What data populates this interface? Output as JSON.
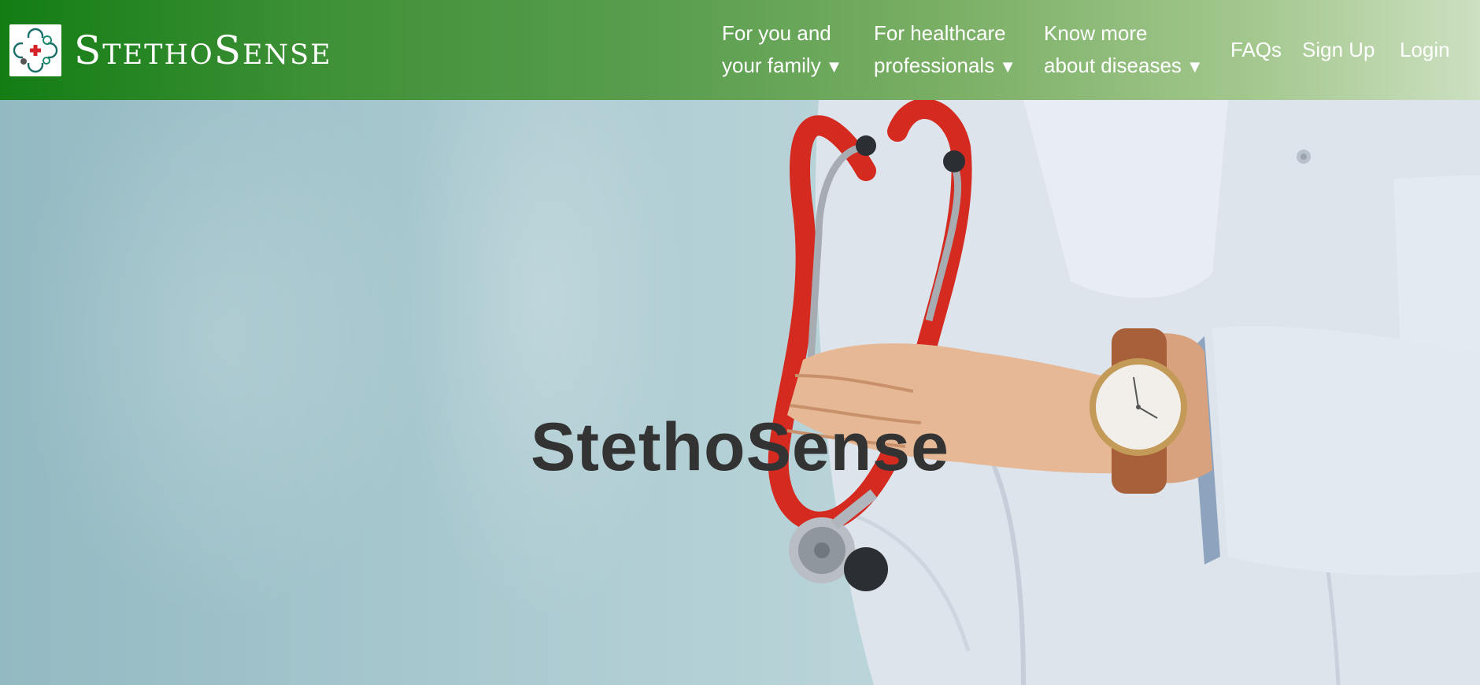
{
  "brand": {
    "name": "StethoSense",
    "logo": "stethoscope-medical-cross-logo"
  },
  "nav": {
    "items": [
      {
        "line1": "For you and",
        "line2": "your family",
        "caret": "▼"
      },
      {
        "line1": "For healthcare",
        "line2": "professionals",
        "caret": "▼"
      },
      {
        "line1": "Know more",
        "line2": "about diseases",
        "caret": "▼"
      }
    ],
    "faqs": "FAQs",
    "signup": "Sign Up",
    "login": "Login"
  },
  "hero": {
    "title": "StethoSense",
    "image": "doctor in white coat holding red stethoscope"
  },
  "colors": {
    "header_start": "#137d14",
    "header_end": "#cde0c1",
    "hero_title": "#333333",
    "stethoscope_tube": "#d42a1f"
  }
}
